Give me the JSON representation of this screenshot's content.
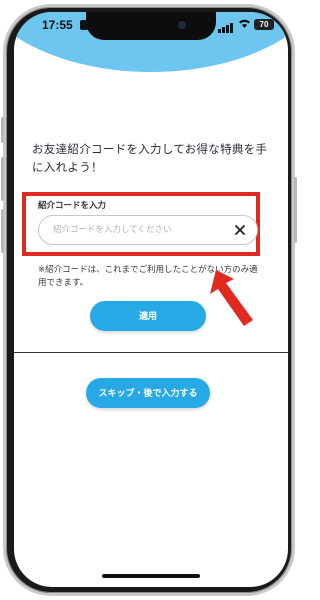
{
  "status_bar": {
    "time": "17:55",
    "battery": "70"
  },
  "instruction": "お友達紹介コードを入力してお得な特典を手に入れよう！",
  "referral": {
    "label": "紹介コードを入力",
    "placeholder": "紹介コードを入力してください",
    "value": ""
  },
  "note": "※紹介コードは、これまでご利用したことがない方のみ適用できます。",
  "buttons": {
    "apply": "適用",
    "skip": "スキップ・後で入力する"
  },
  "colors": {
    "accent": "#27a9e6",
    "header_blob": "#6cc6ef",
    "highlight": "#e02a1f"
  },
  "icons": {
    "clear": "close-icon",
    "annotation": "arrow-icon"
  }
}
